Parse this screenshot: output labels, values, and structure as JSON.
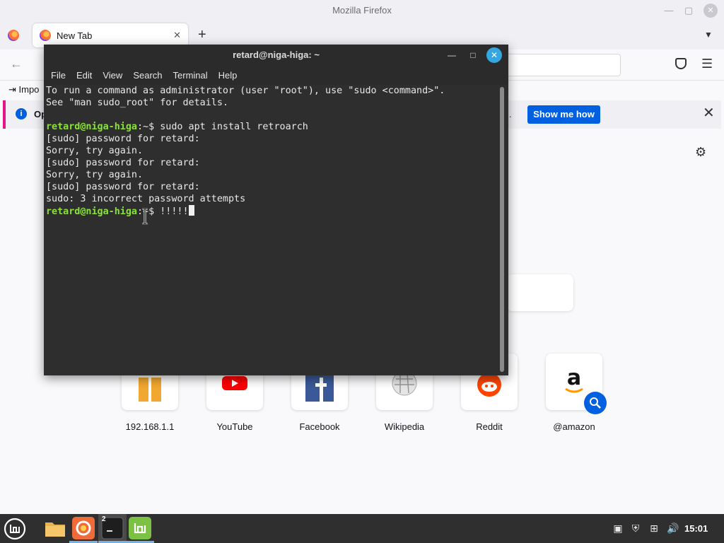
{
  "firefox": {
    "window_title": "Mozilla Firefox",
    "tab_label": "New Tab",
    "bookmarks_import_label": "Impo",
    "notification_text": "Op",
    "notification_tail": ".",
    "notification_button": "Show me how",
    "accent_color": "#0060df",
    "shortcuts": [
      {
        "label": "192.168.1.1",
        "icon": "shortcut-letter-icon"
      },
      {
        "label": "YouTube",
        "icon": "youtube-icon"
      },
      {
        "label": "Facebook",
        "icon": "facebook-icon"
      },
      {
        "label": "Wikipedia",
        "icon": "wikipedia-icon"
      },
      {
        "label": "Reddit",
        "icon": "reddit-icon"
      },
      {
        "label": "@amazon",
        "icon": "amazon-icon"
      }
    ]
  },
  "terminal": {
    "title": "retard@niga-higa: ~",
    "menu": [
      "File",
      "Edit",
      "View",
      "Search",
      "Terminal",
      "Help"
    ],
    "prompt_color": "#8ae234",
    "lines": [
      {
        "type": "text",
        "text": "To run a command as administrator (user \"root\"), use \"sudo <command>\"."
      },
      {
        "type": "text",
        "text": "See \"man sudo_root\" for details."
      },
      {
        "type": "text",
        "text": ""
      },
      {
        "type": "prompt",
        "prompt": "retard@niga-higa",
        "path": ":~$ ",
        "command": "sudo apt install retroarch"
      },
      {
        "type": "text",
        "text": "[sudo] password for retard:"
      },
      {
        "type": "text",
        "text": "Sorry, try again."
      },
      {
        "type": "text",
        "text": "[sudo] password for retard:"
      },
      {
        "type": "text",
        "text": "Sorry, try again."
      },
      {
        "type": "text",
        "text": "[sudo] password for retard:"
      },
      {
        "type": "text",
        "text": "sudo: 3 incorrect password attempts"
      },
      {
        "type": "prompt",
        "prompt": "retard@niga-higa",
        "path": ":~$ ",
        "command": "!!!!!",
        "cursor": true
      }
    ]
  },
  "taskbar": {
    "terminal_badge": "2",
    "clock": "15:01"
  }
}
